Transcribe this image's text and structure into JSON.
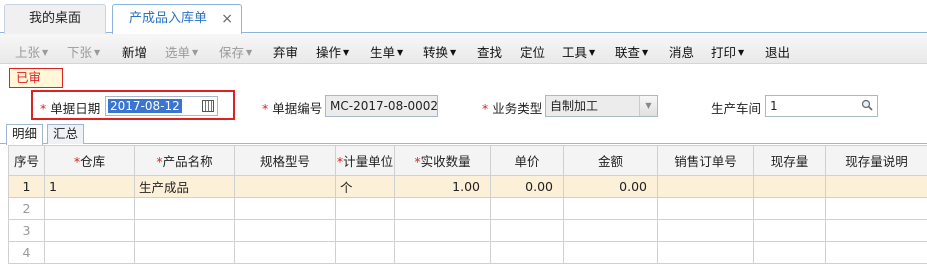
{
  "tabs": [
    {
      "label": "我的桌面"
    },
    {
      "label": "产成品入库单",
      "close": "×"
    }
  ],
  "toolbar": [
    {
      "label": "上张",
      "arrow": "▼",
      "disabled": true
    },
    {
      "label": "下张",
      "arrow": "▼",
      "disabled": true
    },
    {
      "label": "新增",
      "arrow": "",
      "disabled": false
    },
    {
      "label": "选单",
      "arrow": "▼",
      "disabled": true
    },
    {
      "label": "保存",
      "arrow": "▼",
      "disabled": true
    },
    {
      "label": "弃审",
      "arrow": "",
      "disabled": false
    },
    {
      "label": "操作",
      "arrow": "▼",
      "disabled": false
    },
    {
      "label": "生单",
      "arrow": "▼",
      "disabled": false
    },
    {
      "label": "转换",
      "arrow": "▼",
      "disabled": false
    },
    {
      "label": "查找",
      "arrow": "",
      "disabled": false
    },
    {
      "label": "定位",
      "arrow": "",
      "disabled": false
    },
    {
      "label": "工具",
      "arrow": "▼",
      "disabled": false
    },
    {
      "label": "联查",
      "arrow": "▼",
      "disabled": false
    },
    {
      "label": "消息",
      "arrow": "",
      "disabled": false
    },
    {
      "label": "打印",
      "arrow": "▼",
      "disabled": false
    },
    {
      "label": "退出",
      "arrow": "",
      "disabled": false
    }
  ],
  "status": "已审",
  "form": {
    "required_mark": "*",
    "date_label": "单据日期",
    "date_value": "2017-08-12",
    "code_label": "单据编号",
    "code_value": "MC-2017-08-0002",
    "type_label": "业务类型",
    "type_value": "自制加工",
    "workshop_label": "生产车间",
    "workshop_value": "1"
  },
  "subtabs": [
    {
      "label": "明细"
    },
    {
      "label": "汇总"
    }
  ],
  "grid": {
    "columns": [
      {
        "label": "序号",
        "required": false
      },
      {
        "label": "仓库",
        "required": true
      },
      {
        "label": "产品名称",
        "required": true
      },
      {
        "label": "规格型号",
        "required": false
      },
      {
        "label": "计量单位",
        "required": true
      },
      {
        "label": "实收数量",
        "required": true
      },
      {
        "label": "单价",
        "required": false
      },
      {
        "label": "金额",
        "required": false
      },
      {
        "label": "销售订单号",
        "required": false
      },
      {
        "label": "现存量",
        "required": false
      },
      {
        "label": "现存量说明",
        "required": false
      }
    ],
    "rows": [
      {
        "no": "1",
        "warehouse": "1",
        "product": "生产成品",
        "spec": "",
        "unit": "个",
        "qty": "1.00",
        "price": "0.00",
        "amount": "0.00",
        "so": "",
        "stock": "",
        "stock_note": ""
      },
      {
        "no": "2"
      },
      {
        "no": "3"
      },
      {
        "no": "4"
      }
    ]
  },
  "colors": {
    "accent": "#2a74c0",
    "status_red": "#dd2222",
    "row_highlight": "#fdf0d8",
    "selection": "#3a75d0"
  }
}
